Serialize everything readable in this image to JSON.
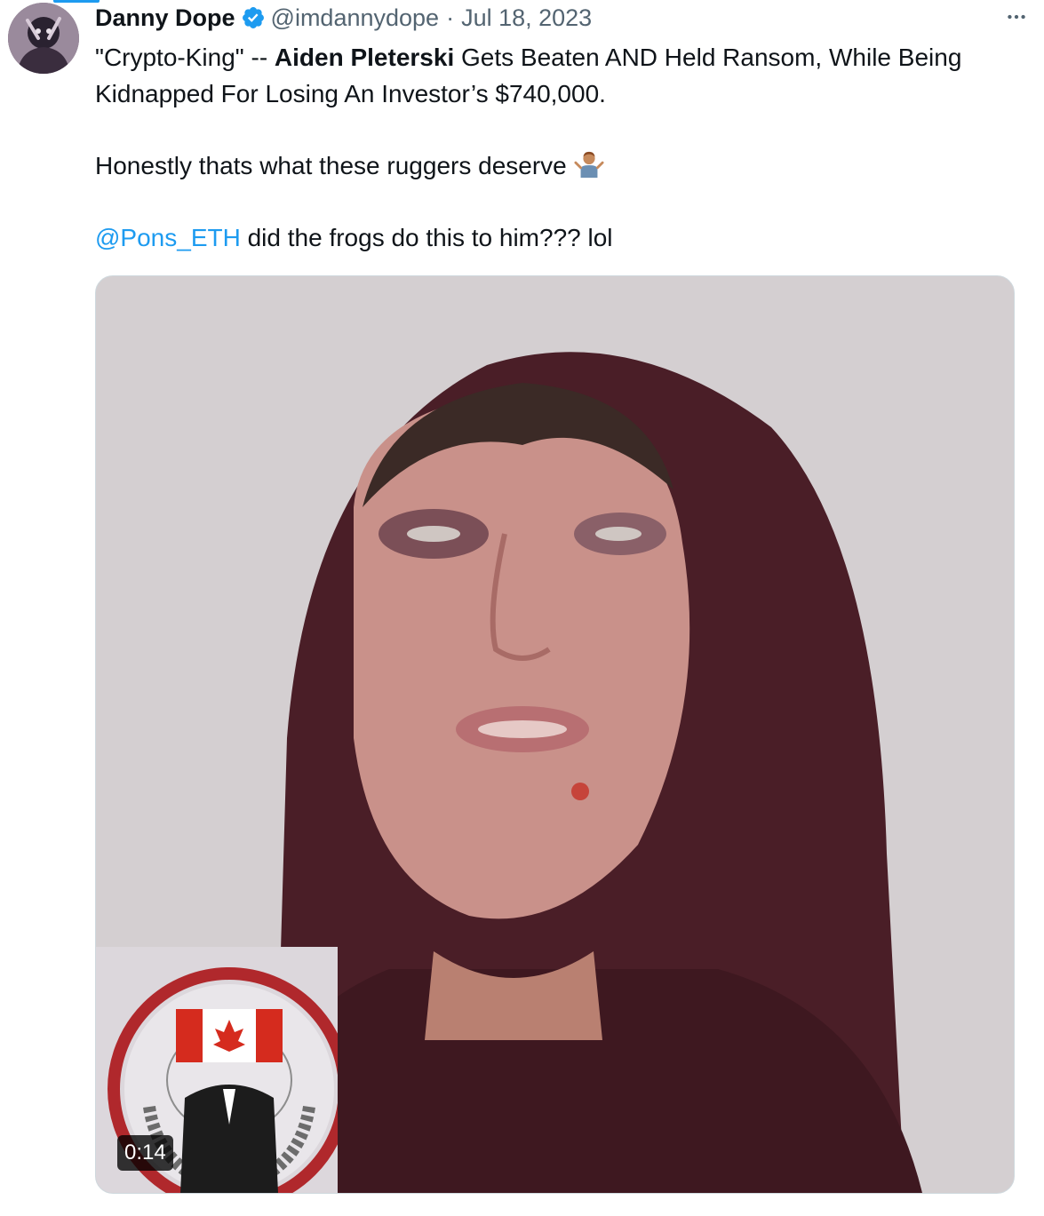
{
  "tweet": {
    "display_name": "Danny Dope",
    "verified": true,
    "handle": "@imdannydope",
    "separator": "·",
    "date": "Jul 18, 2023",
    "more_icon": "more-horizontal-icon",
    "text": {
      "line1_prefix": "\"Crypto-King\" -- ",
      "line1_bold": "Aiden Pleterski",
      "line1_suffix": " Gets Beaten AND Held Ransom, While Being Kidnapped For Losing An Investor’s $740,000.",
      "line2": "Honestly thats what these ruggers deserve ",
      "line2_emoji": "man-shrugging-emoji",
      "mention": "@Pons_ETH",
      "line3_rest": " did the frogs do this to him??? lol"
    },
    "media": {
      "type": "video",
      "duration": "0:14"
    }
  },
  "colors": {
    "accent": "#1d9bf0",
    "text": "#0f1419",
    "secondary": "#536471",
    "hoodie": "#4a1e27"
  }
}
